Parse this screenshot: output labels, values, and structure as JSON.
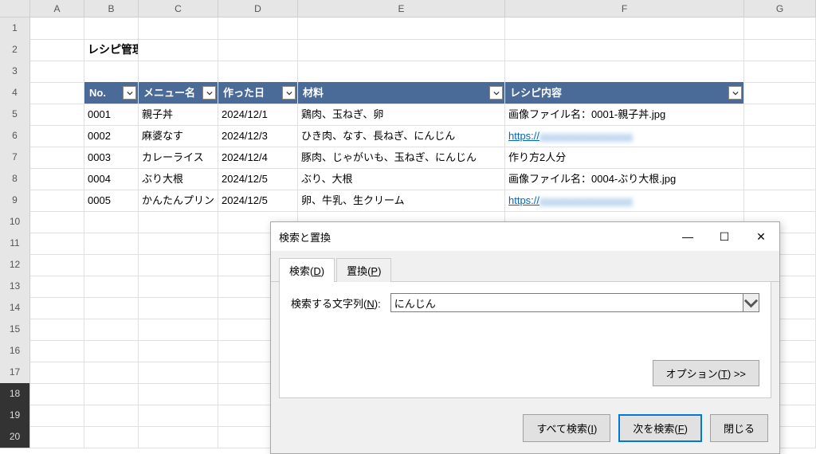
{
  "columns": [
    "",
    "A",
    "B",
    "C",
    "D",
    "E",
    "F",
    "G"
  ],
  "row_headers": [
    "1",
    "2",
    "3",
    "4",
    "5",
    "6",
    "7",
    "8",
    "9",
    "10",
    "11",
    "12",
    "13",
    "14",
    "15",
    "16",
    "17",
    "18",
    "19",
    "20"
  ],
  "title": "レシピ管理リスト",
  "table": {
    "headers": {
      "no": "No.",
      "menu": "メニュー名",
      "date": "作った日",
      "ingredients": "材料",
      "recipe": "レシピ内容"
    },
    "rows": [
      {
        "no": "0001",
        "menu": "親子丼",
        "date": "2024/12/1",
        "ingredients": "鶏肉、玉ねぎ、卵",
        "recipe": "画像ファイル名：0001-親子丼.jpg"
      },
      {
        "no": "0002",
        "menu": "麻婆なす",
        "date": "2024/12/3",
        "ingredients": "ひき肉、なす、長ねぎ、にんじん",
        "recipe": "https://"
      },
      {
        "no": "0003",
        "menu": "カレーライス",
        "date": "2024/12/4",
        "ingredients": "豚肉、じゃがいも、玉ねぎ、にんじん",
        "recipe": "作り方2人分"
      },
      {
        "no": "0004",
        "menu": "ぶり大根",
        "date": "2024/12/5",
        "ingredients": "ぶり、大根",
        "recipe": "画像ファイル名：0004-ぶり大根.jpg"
      },
      {
        "no": "0005",
        "menu": "かんたんプリン",
        "date": "2024/12/5",
        "ingredients": "卵、牛乳、生クリーム",
        "recipe": "https://"
      }
    ]
  },
  "dialog": {
    "title": "検索と置換",
    "tabs": {
      "find": "検索(D)",
      "replace": "置換(P)"
    },
    "find_label": "検索する文字列(N):",
    "find_value": "にんじん",
    "options_btn": "オプション(T) >>",
    "find_all_btn": "すべて検索(I)",
    "find_next_btn": "次を検索(F)",
    "close_btn": "閉じる"
  }
}
